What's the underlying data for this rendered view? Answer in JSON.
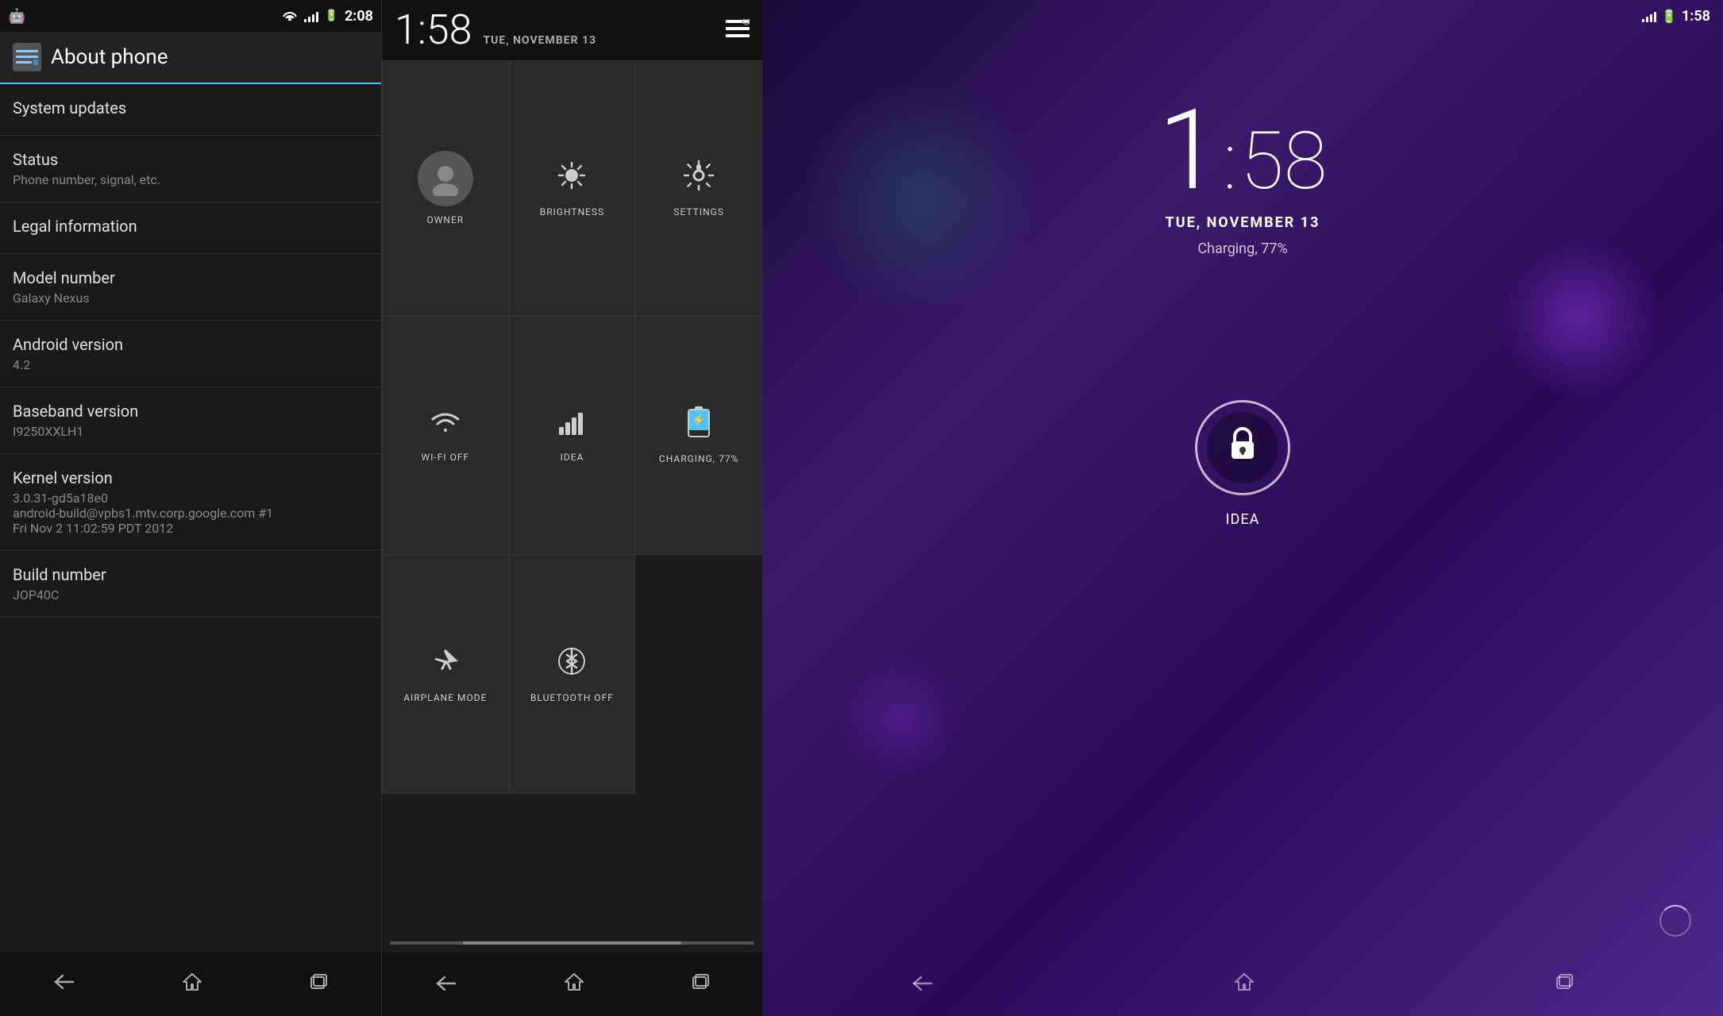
{
  "panel1": {
    "statusBar": {
      "time": "2:08"
    },
    "header": {
      "title": "About phone",
      "iconLabel": "☰"
    },
    "items": [
      {
        "id": "system-updates",
        "title": "System updates",
        "subtitle": ""
      },
      {
        "id": "status",
        "title": "Status",
        "subtitle": "Phone number, signal, etc."
      },
      {
        "id": "legal",
        "title": "Legal information",
        "subtitle": ""
      },
      {
        "id": "model",
        "title": "Model number",
        "subtitle": "Galaxy Nexus"
      },
      {
        "id": "android",
        "title": "Android version",
        "subtitle": "4.2"
      },
      {
        "id": "baseband",
        "title": "Baseband version",
        "subtitle": "I9250XXLH1"
      },
      {
        "id": "kernel",
        "title": "Kernel version",
        "subtitle": "3.0.31-gd5a18e0\nandroid-build@vpbs1.mtv.corp.google.com #1\nFri Nov 2 11:02:59 PDT 2012"
      },
      {
        "id": "build",
        "title": "Build number",
        "subtitle": "JOP40C"
      }
    ],
    "navBar": {
      "back": "←",
      "home": "⌂",
      "recents": "▣"
    }
  },
  "panel2": {
    "header": {
      "time": "1:58",
      "date": "TUE, NOVEMBER 13",
      "menuIcon": "☰"
    },
    "tiles": [
      {
        "id": "owner",
        "icon": "👤",
        "label": "OWNER",
        "type": "owner"
      },
      {
        "id": "brightness",
        "icon": "☀",
        "label": "BRIGHTNESS"
      },
      {
        "id": "settings",
        "icon": "⚙",
        "label": "SETTINGS"
      },
      {
        "id": "wifi",
        "icon": "▽",
        "label": "WI-FI OFF"
      },
      {
        "id": "idea",
        "icon": "📶",
        "label": "IDEA"
      },
      {
        "id": "charging",
        "icon": "⚡",
        "label": "CHARGING, 77%"
      },
      {
        "id": "airplane",
        "icon": "✈",
        "label": "AIRPLANE MODE"
      },
      {
        "id": "bluetooth",
        "icon": "⊛",
        "label": "BLUETOOTH OFF"
      }
    ],
    "navBar": {
      "back": "←",
      "home": "⌂",
      "recents": "▣"
    }
  },
  "panel3": {
    "statusBar": {
      "time": "1:58"
    },
    "time": {
      "hour": "1",
      "colon": ":",
      "minute": "58"
    },
    "date": "TUE, NOVEMBER 13",
    "charging": "Charging, 77%",
    "lockLabel": "🔒",
    "carrier": "IDEA",
    "navBar": {
      "back": "←",
      "home": "⌂",
      "recents": "▣"
    }
  }
}
